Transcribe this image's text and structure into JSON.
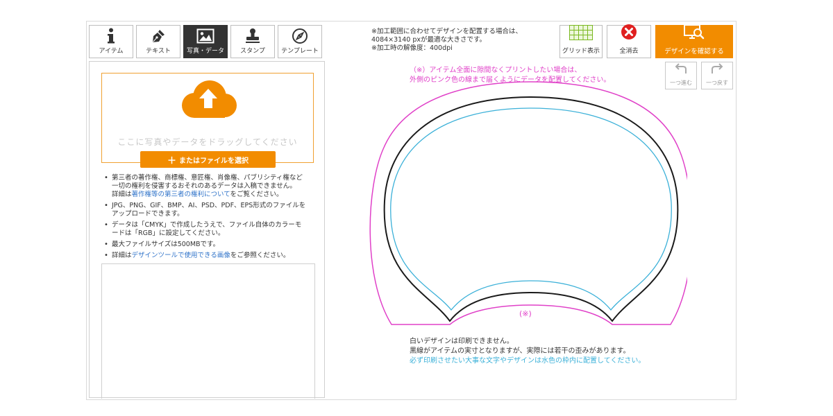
{
  "tabs": [
    {
      "label": "アイテム",
      "icon": "info-icon"
    },
    {
      "label": "テキスト",
      "icon": "pen-nib-icon"
    },
    {
      "label": "写真・データ",
      "icon": "image-icon",
      "active": true
    },
    {
      "label": "スタンプ",
      "icon": "stamp-icon"
    },
    {
      "label": "テンプレート",
      "icon": "compass-icon"
    }
  ],
  "upload": {
    "drop_text": "ここに写真やデータをドラッグしてください",
    "select_label": "またはファイルを選択",
    "plus": "＋"
  },
  "notes": {
    "n1_line1": "第三者の著作権、商標権、意匠権、肖像権、パブリシティ権など",
    "n1_line2": "一切の権利を侵害するおそれのあるデータは入稿できません。",
    "n1_line3_prefix": "詳細は",
    "n1_line3_link": "著作権等の第三者の権利について",
    "n1_line3_suffix": "をご覧ください。",
    "n2_line1": "JPG、PNG、GIF、BMP、AI、PSD、PDF、EPS形式のファイルを",
    "n2_line2": "アップロードできます。",
    "n3_line1": "データは「CMYK」で作成したうえで、ファイル自体のカラーモ",
    "n3_line2": "ードは「RGB」に設定してください。",
    "n4": "最大ファイルサイズは500MBです。",
    "n5_prefix": "詳細は",
    "n5_link": "デザインツールで使用できる画像",
    "n5_suffix": "をご参照ください。"
  },
  "info": {
    "line1": "※加工範囲に合わせてデザインを配置する場合は、",
    "line2": "4084×3140 pxが最適な大きさです。",
    "line3": "※加工時の解像度：400dpi"
  },
  "toolbar": {
    "grid_label": "グリッド表示",
    "clear_label": "全消去",
    "confirm_label": "デザインを確認する",
    "redo_label": "一つ進む",
    "undo_label": "一つ戻す"
  },
  "canvas": {
    "pink_note_line1": "（※）アイテム全面に隙間なくプリントしたい場合は、",
    "pink_note_line2": "外側のピンク色の線まで届くようにデータを配置してください。",
    "mark": "(※)"
  },
  "bottom": {
    "line1": "白いデザインは印刷できません。",
    "line2": "黒線がアイテムの実寸となりますが、実際には若干の歪みがあります。",
    "line3": "必ず印刷させたい大事な文字やデザインは水色の枠内に配置してください。"
  },
  "colors": {
    "accent": "#f28c00",
    "pink": "#e040c8",
    "cyan": "#3ab0d8",
    "link": "#2f73c9",
    "clear_red": "#e02020",
    "grid_green": "#7ab820"
  }
}
